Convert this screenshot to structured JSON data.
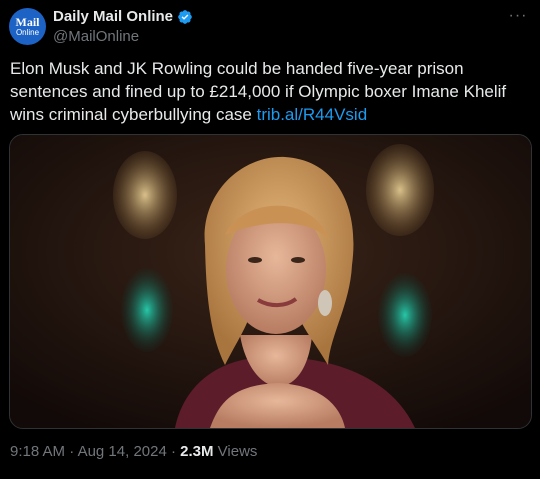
{
  "author": {
    "avatar_line1": "Mail",
    "avatar_line2": "Online",
    "name": "Daily Mail Online",
    "handle": "@MailOnline"
  },
  "tweet": {
    "text": "Elon Musk and JK Rowling could be handed five-year prison sentences and fined up to £214,000 if Olympic boxer Imane Khelif wins criminal cyberbullying case ",
    "link": "trib.al/R44Vsid"
  },
  "meta": {
    "time": "9:18 AM",
    "sep1": " · ",
    "date": "Aug 14, 2024",
    "sep2": " · ",
    "views_count": "2.3M",
    "views_label": " Views"
  },
  "more_glyph": "···",
  "colors": {
    "background": "#000000",
    "text": "#e7e9ea",
    "secondary": "#71767b",
    "link": "#1d9bf0",
    "verified": "#1d9bf0",
    "avatar_bg": "#1d63c6"
  }
}
